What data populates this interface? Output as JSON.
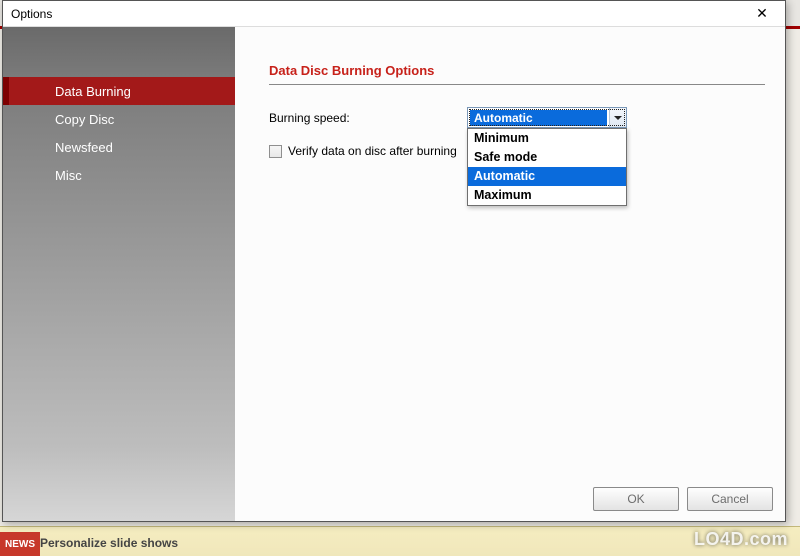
{
  "window": {
    "title": "Options",
    "close_glyph": "✕"
  },
  "sidebar": {
    "items": [
      {
        "label": "Data Burning",
        "active": true
      },
      {
        "label": "Copy Disc",
        "active": false
      },
      {
        "label": "Newsfeed",
        "active": false
      },
      {
        "label": "Misc",
        "active": false
      }
    ]
  },
  "content": {
    "section_title": "Data Disc Burning Options",
    "burning_speed_label": "Burning speed:",
    "burning_speed_value": "Automatic",
    "burning_speed_options": [
      "Minimum",
      "Safe mode",
      "Automatic",
      "Maximum"
    ],
    "verify_label": "Verify data on disc after burning",
    "verify_checked": false
  },
  "buttons": {
    "ok": "OK",
    "cancel": "Cancel"
  },
  "background": {
    "news_tag": "NEWS",
    "footer_text": "Personalize slide shows"
  },
  "watermark": "LO4D.com"
}
